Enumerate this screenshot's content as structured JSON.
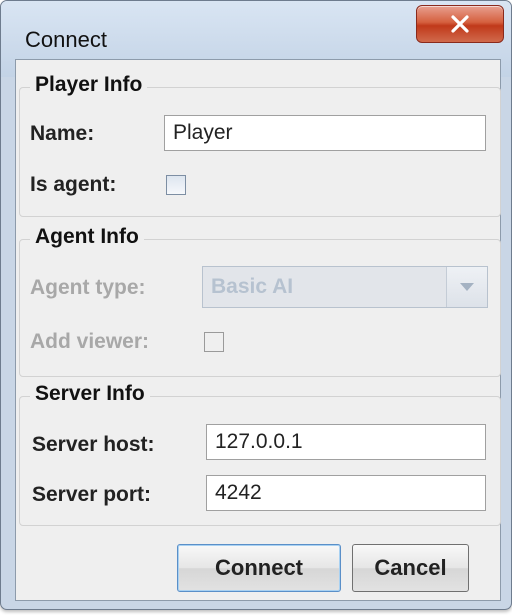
{
  "window": {
    "title": "Connect"
  },
  "player_info": {
    "title": "Player Info",
    "name_label": "Name:",
    "name_value": "Player",
    "is_agent_label": "Is agent:",
    "is_agent_checked": false
  },
  "agent_info": {
    "title": "Agent Info",
    "agent_type_label": "Agent type:",
    "agent_type_value": "Basic AI",
    "add_viewer_label": "Add viewer:",
    "add_viewer_checked": false,
    "disabled": true
  },
  "server_info": {
    "title": "Server Info",
    "host_label": "Server host:",
    "host_value": "127.0.0.1",
    "port_label": "Server port:",
    "port_value": "4242"
  },
  "buttons": {
    "connect_label": "Connect",
    "cancel_label": "Cancel"
  },
  "colors": {
    "window_frame": "#c9d6e6",
    "close_button": "#c0391a",
    "panel_background": "#efefef",
    "disabled_text": "#a8a8a8"
  }
}
